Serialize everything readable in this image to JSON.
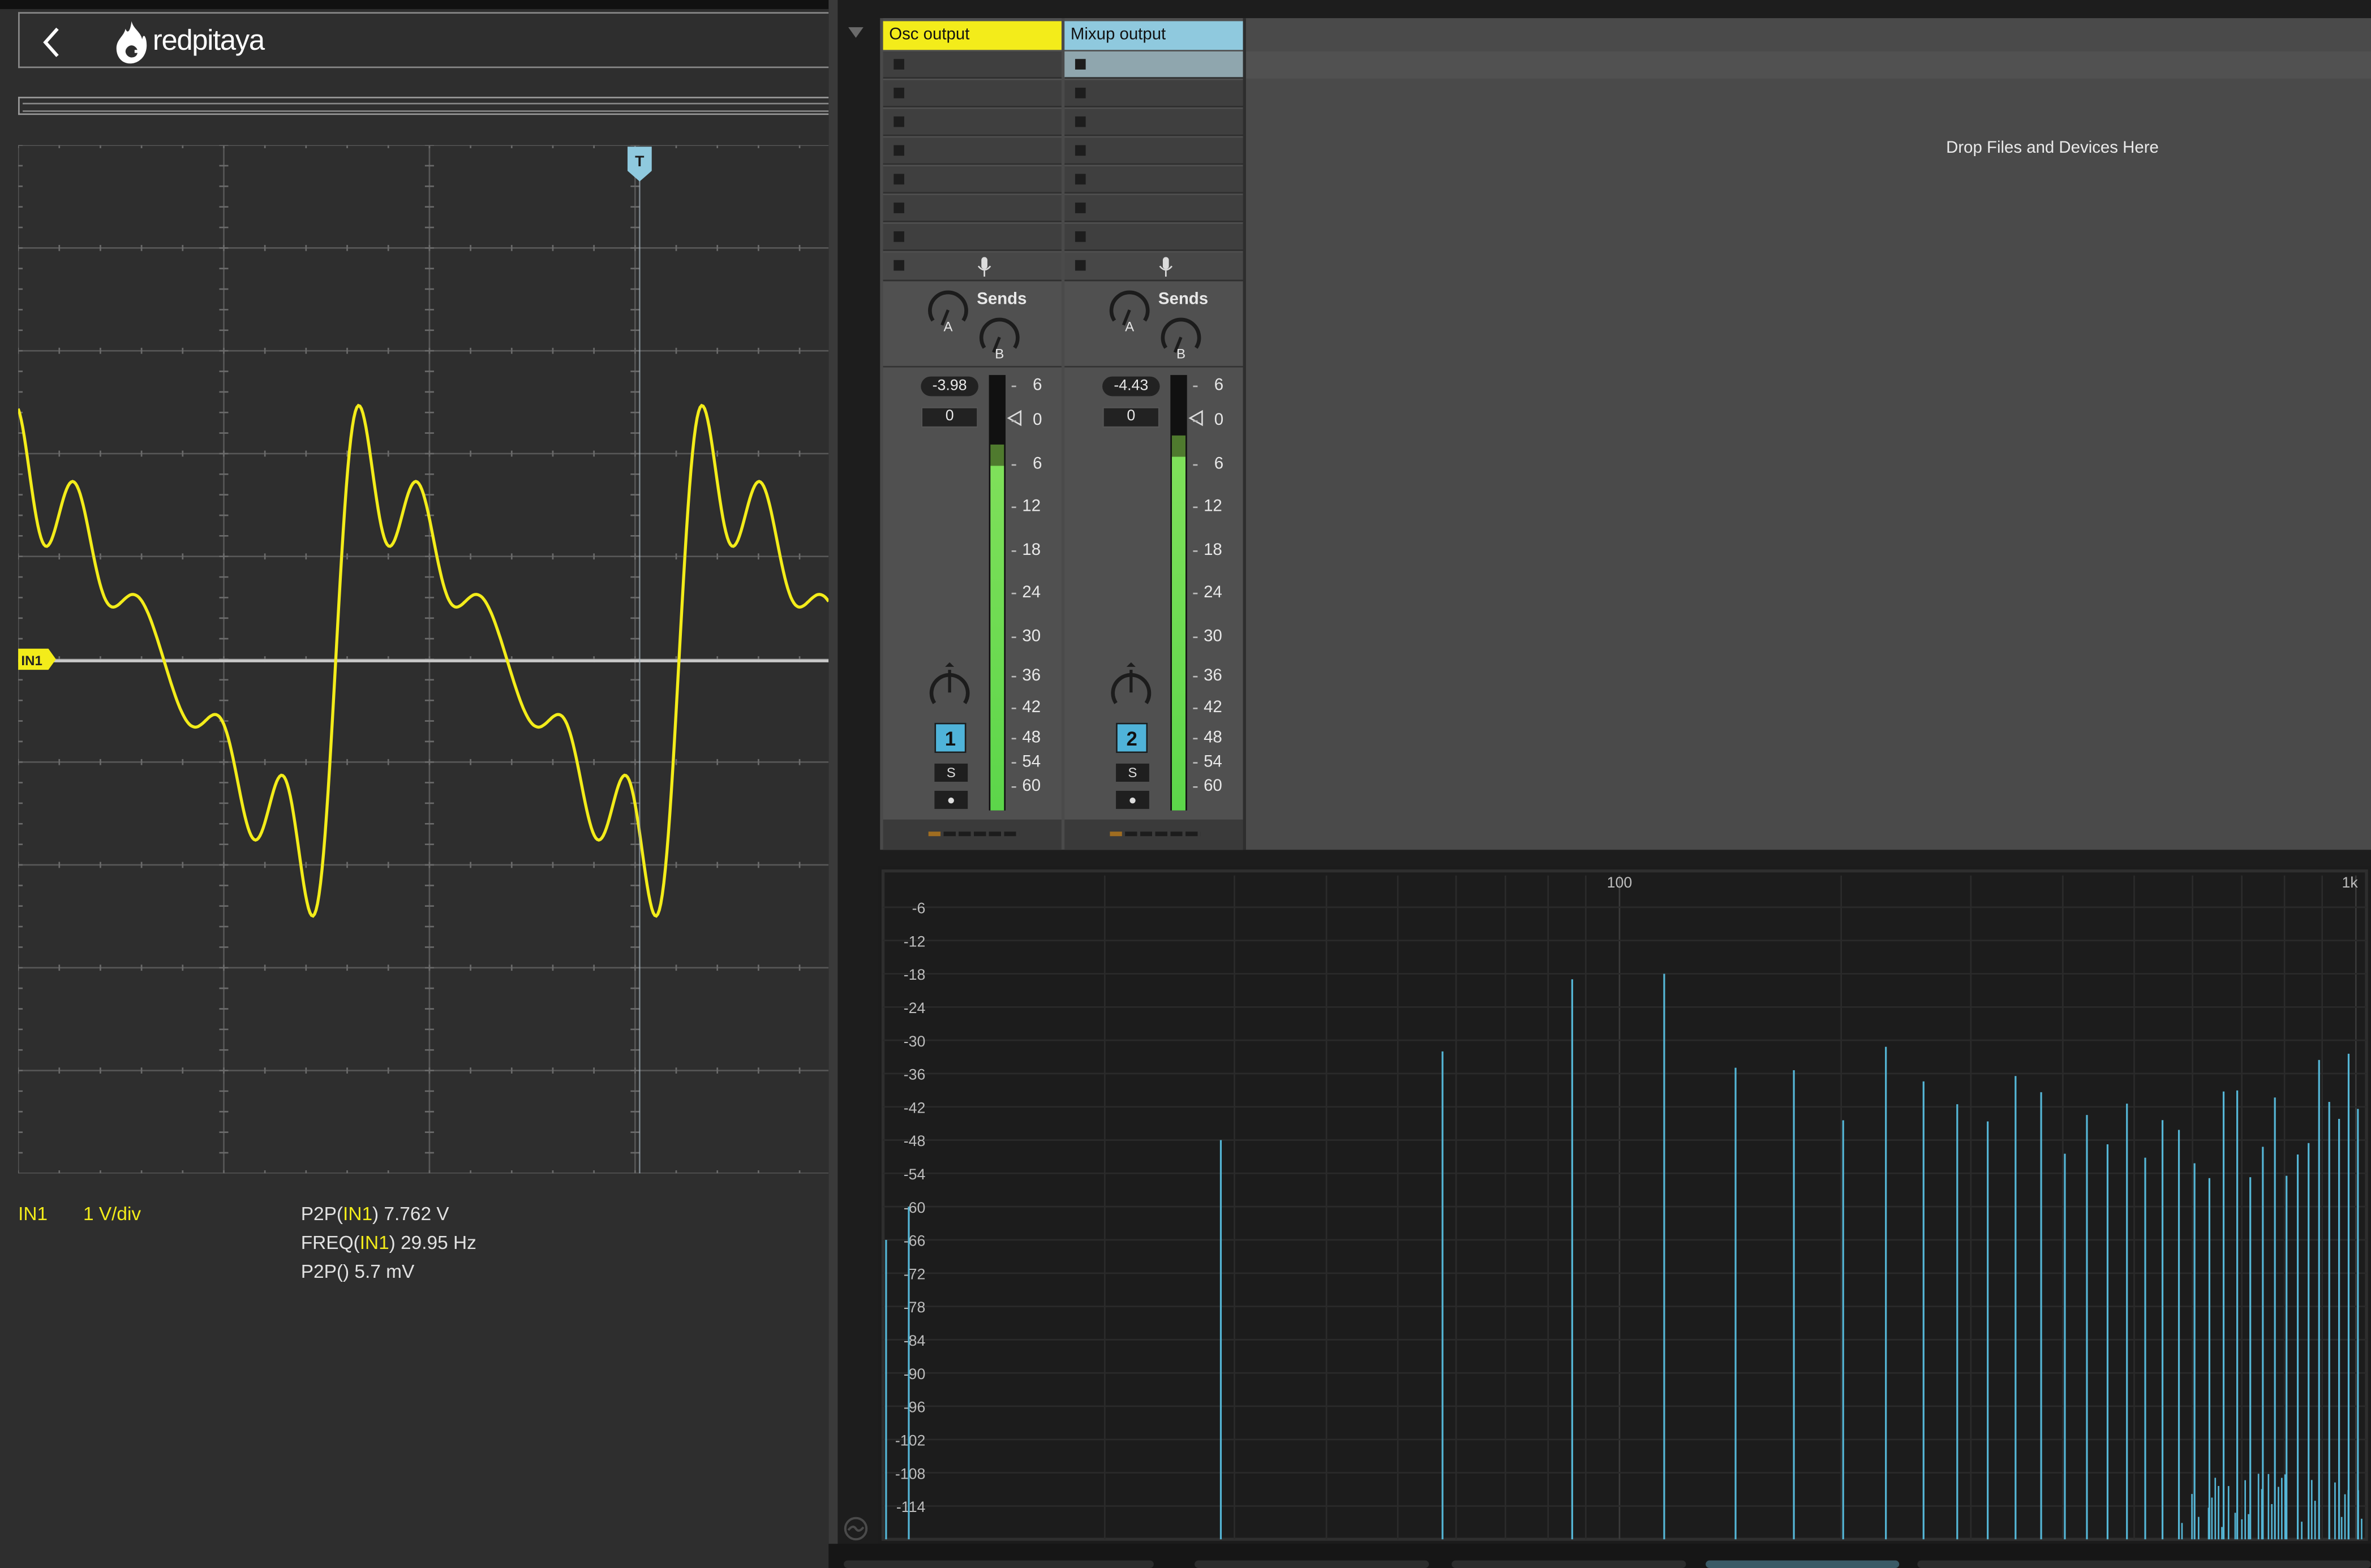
{
  "oscilloscope": {
    "brand": "redpitaya",
    "trigger_marker": "T",
    "channel_marker": "IN1",
    "channel": "IN1",
    "scale": "1 V/div",
    "measurements": {
      "p2p_prefix": "P2P(",
      "p2p_ch": "IN1",
      "p2p_value": ") 7.762 V",
      "freq_prefix": "FREQ(",
      "freq_ch": "IN1",
      "freq_value": ") 29.95 Hz",
      "p2p_empty": "P2P() 5.7 mV"
    },
    "colors": {
      "trace": "#f3ec1a",
      "background": "#2e2e2e",
      "grid": "#5a5a5a"
    }
  },
  "ableton": {
    "drop_text": "Drop Files and Devices Here",
    "tracks": [
      {
        "name": "Osc output",
        "color": "#f3ec1a",
        "volume": "-3.98",
        "pan": "0",
        "number": "1",
        "solo": "S",
        "arm": "●",
        "sends_label": "Sends",
        "send_a": "A",
        "send_b": "B",
        "meter_level": 0.84
      },
      {
        "name": "Mixup output",
        "color": "#8fc9de",
        "volume": "-4.43",
        "pan": "0",
        "number": "2",
        "solo": "S",
        "arm": "●",
        "sends_label": "Sends",
        "send_a": "A",
        "send_b": "B",
        "meter_level": 0.86
      }
    ],
    "meter_ticks": [
      "6",
      "0",
      "6",
      "12",
      "18",
      "24",
      "30",
      "36",
      "42",
      "48",
      "54",
      "60"
    ]
  },
  "spectrum": {
    "x_labels": [
      "100",
      "1k"
    ],
    "y_labels": [
      "-6",
      "-12",
      "-18",
      "-24",
      "-30",
      "-36",
      "-42",
      "-48",
      "-54",
      "-60",
      "-66",
      "-72",
      "-78",
      "-84",
      "-90",
      "-96",
      "-102",
      "-108",
      "-114"
    ],
    "bar_color": "#55b6d6"
  }
}
